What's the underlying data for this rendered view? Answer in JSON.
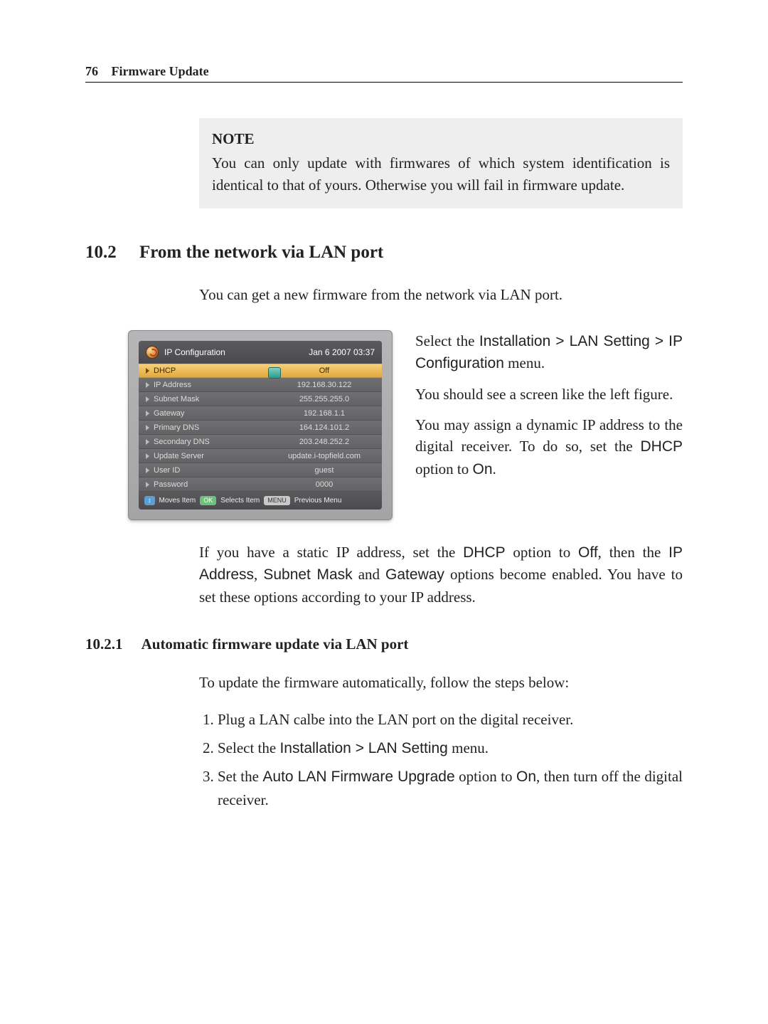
{
  "page": {
    "number": "76",
    "chapter": "Firmware Update"
  },
  "note": {
    "title": "NOTE",
    "body": "You can only update with firmwares of which system identification is identical to that of yours. Otherwise you will fail in firmware update."
  },
  "section": {
    "number": "10.2",
    "title": "From the network via LAN port",
    "intro": "You can get a new firmware from the network via LAN port."
  },
  "side": {
    "p1a": "Select the ",
    "p1_path": "Installation > LAN Setting > IP Configuration",
    "p1b": " menu.",
    "p2": "You should see a screen like the left figure.",
    "p3a": "You may assign a dynamic IP address to the digital receiver. To do so, set the ",
    "p3_dhcp": "DHCP",
    "p3b": " option to ",
    "p3_on": "On",
    "p3c": "."
  },
  "after": {
    "a": "If you have a static IP address, set the ",
    "dhcp": "DHCP",
    "b": " option to ",
    "off": "Off",
    "c": ", then the ",
    "ip": "IP Address",
    "comma": ", ",
    "mask": "Subnet Mask",
    "and": " and ",
    "gw": "Gateway",
    "d": " options become enabled. You have to set these options according to your IP address."
  },
  "sub": {
    "number": "10.2.1",
    "title": "Automatic firmware update via LAN port",
    "intro": "To update the firmware automatically, follow the steps below:"
  },
  "steps": {
    "s1": "Plug a LAN calbe into the LAN port on the digital receiver.",
    "s2a": "Select the ",
    "s2_path": "Installation > LAN Setting",
    "s2b": " menu.",
    "s3a": "Set the ",
    "s3_opt": "Auto LAN Firmware Upgrade",
    "s3b": " option to ",
    "s3_on": "On",
    "s3c": ", then turn off the digital receiver."
  },
  "shot": {
    "title": "IP Configuration",
    "datetime": "Jan 6 2007 03:37",
    "rows": [
      {
        "label": "DHCP",
        "value": "Off",
        "selected": true
      },
      {
        "label": "IP Address",
        "value": "192.168.30.122"
      },
      {
        "label": "Subnet Mask",
        "value": "255.255.255.0"
      },
      {
        "label": "Gateway",
        "value": "192.168.1.1"
      },
      {
        "label": "Primary DNS",
        "value": "164.124.101.2"
      },
      {
        "label": "Secondary DNS",
        "value": "203.248.252.2"
      },
      {
        "label": "Update Server",
        "value": "update.i-topfield.com"
      },
      {
        "label": "User ID",
        "value": "guest"
      },
      {
        "label": "Password",
        "value": "0000"
      }
    ],
    "footer": {
      "moves": "Moves Item",
      "ok": "OK",
      "selects": "Selects Item",
      "menu": "MENU",
      "prev": "Previous Menu"
    }
  }
}
